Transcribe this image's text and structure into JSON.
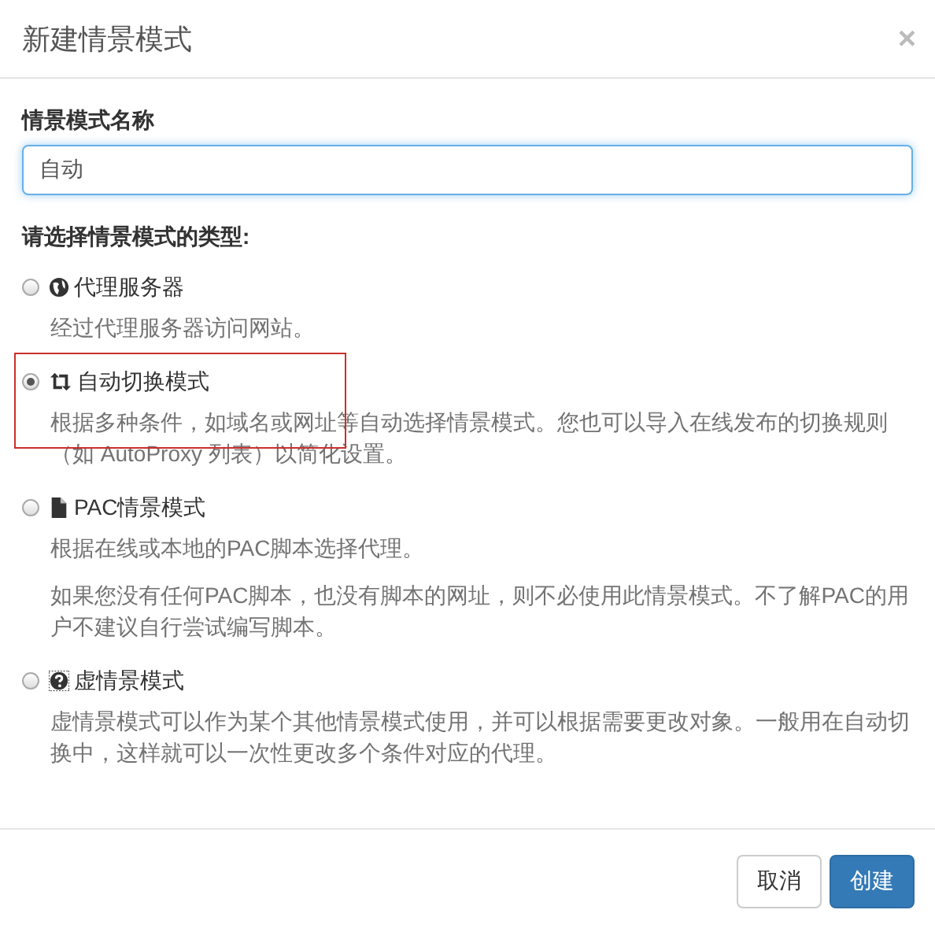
{
  "dialog": {
    "title": "新建情景模式",
    "close": "×"
  },
  "name_field": {
    "label": "情景模式名称",
    "value": "自动"
  },
  "type_label": "请选择情景模式的类型:",
  "options": [
    {
      "kind": "globe",
      "label": "代理服务器",
      "selected": false,
      "highlighted": false,
      "description": [
        "经过代理服务器访问网站。"
      ]
    },
    {
      "kind": "switch",
      "label": "自动切换模式",
      "selected": true,
      "highlighted": true,
      "description": [
        "根据多种条件，如域名或网址等自动选择情景模式。您也可以导入在线发布的切换规则（如 AutoProxy 列表）以简化设置。"
      ]
    },
    {
      "kind": "file",
      "label": "PAC情景模式",
      "selected": false,
      "highlighted": false,
      "description": [
        "根据在线或本地的PAC脚本选择代理。",
        "如果您没有任何PAC脚本，也没有脚本的网址，则不必使用此情景模式。不了解PAC的用户不建议自行尝试编写脚本。"
      ]
    },
    {
      "kind": "question",
      "label": "虚情景模式",
      "selected": false,
      "highlighted": false,
      "description": [
        "虚情景模式可以作为某个其他情景模式使用，并可以根据需要更改对象。一般用在自动切换中，这样就可以一次性更改多个条件对应的代理。"
      ]
    }
  ],
  "buttons": [
    {
      "kind": "default",
      "label": "取消"
    },
    {
      "kind": "primary",
      "label": "创建"
    }
  ]
}
